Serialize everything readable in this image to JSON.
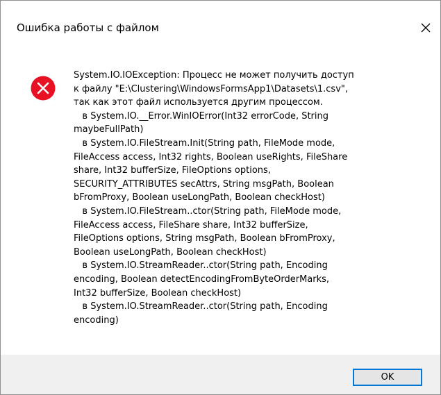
{
  "window": {
    "title": "Ошибка работы с файлом",
    "close_icon": "close-icon"
  },
  "message": {
    "icon": "error-icon",
    "lines": [
      "System.IO.IOException: Процесс не может получить доступ",
      "к файлу \"E:\\Clustering\\WindowsFormsApp1\\Datasets\\1.csv\",",
      "так как этот файл используется другим процессом.",
      "   в System.IO.__Error.WinIOError(Int32 errorCode, String",
      "maybeFullPath)",
      "   в System.IO.FileStream.Init(String path, FileMode mode,",
      "FileAccess access, Int32 rights, Boolean useRights, FileShare",
      "share, Int32 bufferSize, FileOptions options,",
      "SECURITY_ATTRIBUTES secAttrs, String msgPath, Boolean",
      "bFromProxy, Boolean useLongPath, Boolean checkHost)",
      "   в System.IO.FileStream..ctor(String path, FileMode mode,",
      "FileAccess access, FileShare share, Int32 bufferSize,",
      "FileOptions options, String msgPath, Boolean bFromProxy,",
      "Boolean useLongPath, Boolean checkHost)",
      "   в System.IO.StreamReader..ctor(String path, Encoding",
      "encoding, Boolean detectEncodingFromByteOrderMarks,",
      "Int32 bufferSize, Boolean checkHost)",
      "   в System.IO.StreamReader..ctor(String path, Encoding",
      "encoding)"
    ]
  },
  "buttons": {
    "ok_label": "OK"
  },
  "colors": {
    "error_red": "#e81123",
    "footer_bg": "#f0f0f0",
    "button_focus_border": "#0078d7",
    "button_bg": "#e5e5e5"
  }
}
